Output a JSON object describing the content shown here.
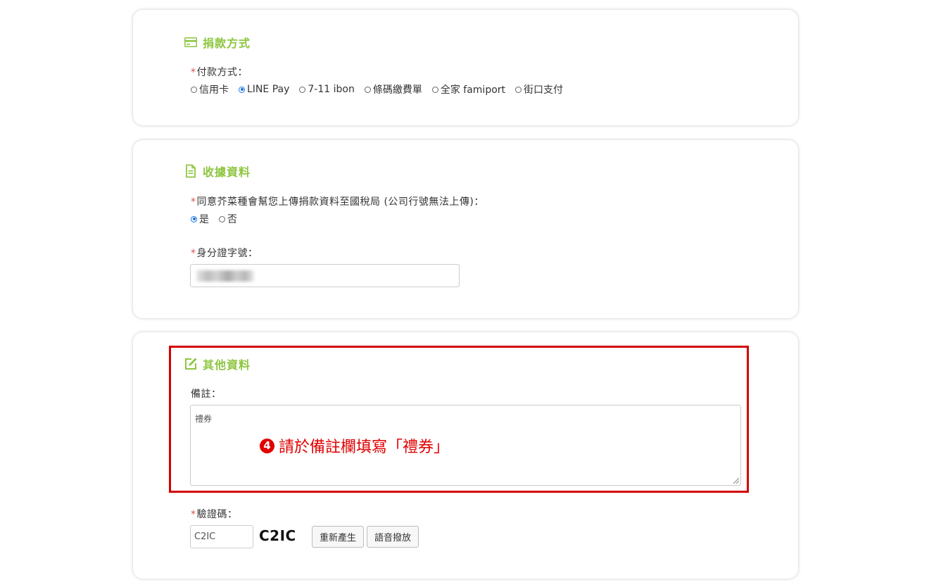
{
  "payment": {
    "title": "捐款方式",
    "icon": "credit-card-icon",
    "method_label": "付款方式：",
    "options": [
      "信用卡",
      "LINE Pay",
      "7-11 ibon",
      "條碼繳費單",
      "全家 famiport",
      "街口支付"
    ],
    "selected": "LINE Pay"
  },
  "receipt": {
    "title": "收據資料",
    "icon": "document-icon",
    "consent_label": "同意芥菜種會幫您上傳捐款資料至國稅局 (公司行號無法上傳)：",
    "consent_options": [
      "是",
      "否"
    ],
    "consent_selected": "是",
    "id_label": "身分證字號："
  },
  "other": {
    "title": "其他資料",
    "icon": "edit-icon",
    "note_label": "備註：",
    "note_value": "禮券",
    "captcha_label": "驗證碼：",
    "captcha_input_value": "C2IC",
    "captcha_image_text": "C2IC",
    "regenerate_button": "重新產生",
    "audio_button": "語音撥放"
  },
  "annotation": {
    "number": "4",
    "text": "請於備註欄填寫「禮券」"
  },
  "colors": {
    "accent_green": "#8dc63f",
    "required_red": "#d9534f",
    "annotation_red": "#e00000",
    "radio_blue": "#1a73e8"
  }
}
